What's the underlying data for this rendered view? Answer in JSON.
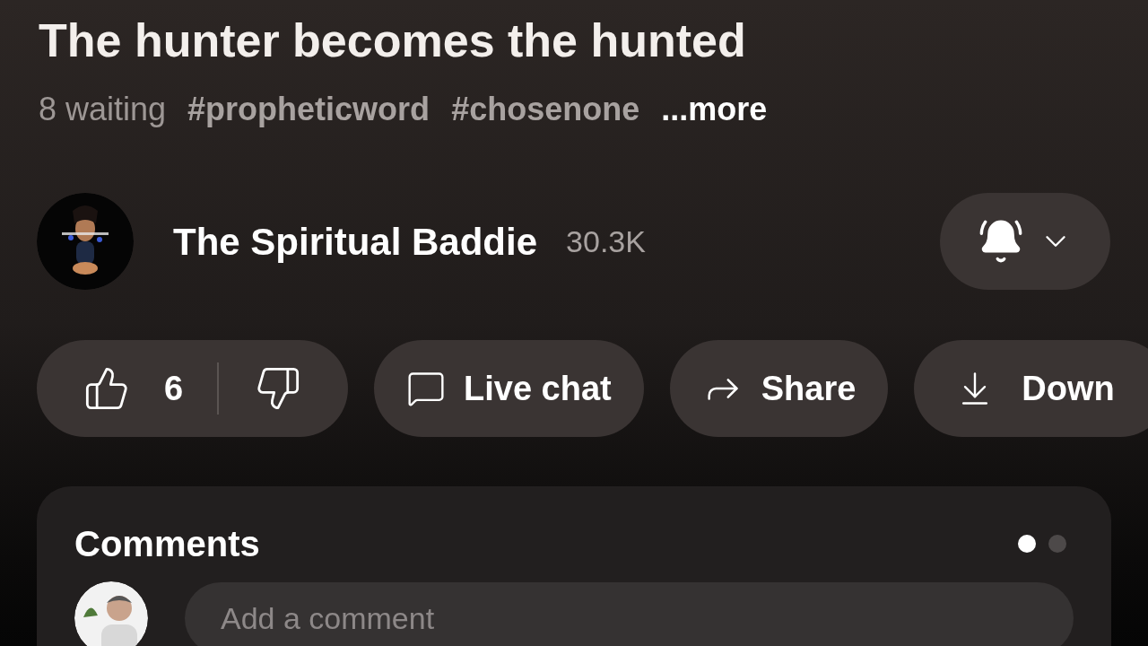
{
  "video": {
    "title": "The hunter becomes the hunted",
    "waiting": "8 waiting",
    "hashtags": [
      "#propheticword",
      "#chosenone"
    ],
    "more": "...more"
  },
  "channel": {
    "name": "The Spiritual Baddie",
    "subscribers": "30.3K",
    "bell_on": true
  },
  "actions": [
    {
      "kind": "like",
      "label": "6"
    },
    {
      "kind": "chat",
      "label": "Live chat"
    },
    {
      "kind": "share",
      "label": "Share"
    },
    {
      "kind": "download",
      "label": "Down"
    }
  ],
  "comments": {
    "title": "Comments",
    "pages": [
      {
        "selected": true
      },
      {
        "selected": false
      }
    ],
    "placeholder": "Add a comment"
  }
}
